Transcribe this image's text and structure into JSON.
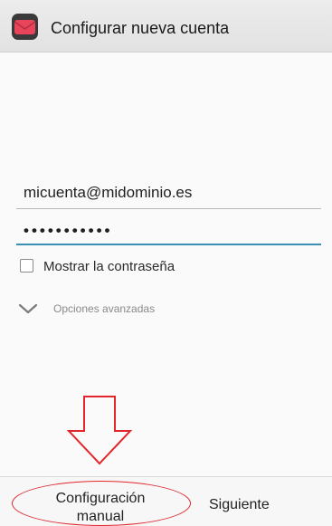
{
  "header": {
    "title": "Configurar nueva cuenta",
    "icon": "email-app-icon"
  },
  "form": {
    "email_value": "micuenta@midominio.es",
    "password_masked": "•••••••••••",
    "show_password_label": "Mostrar la contraseña",
    "show_password_checked": false,
    "advanced_options_label": "Opciones avanzadas"
  },
  "annotation": {
    "arrow": "down-arrow-outline",
    "highlight_color": "#e3262b"
  },
  "footer": {
    "manual_setup_line1": "Configuración",
    "manual_setup_line2": "manual",
    "next_label": "Siguiente"
  },
  "colors": {
    "accent": "#3a8fb7",
    "icon_red": "#e8455a"
  }
}
